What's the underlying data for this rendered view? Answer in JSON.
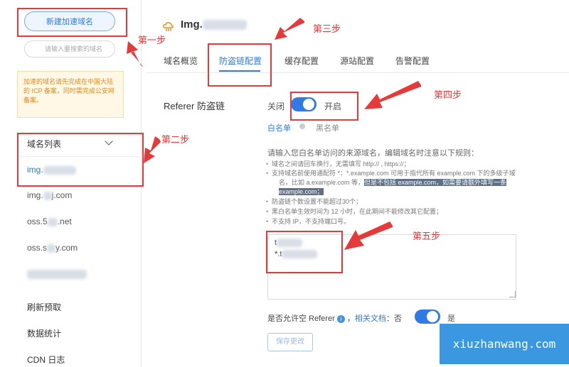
{
  "sidebar": {
    "new_domain_button": "新建加速域名",
    "search_placeholder": "请输入要搜索的域名",
    "notice": "加速的域名请先完成在中国大陆的 ICP 备案，同时需完成公安网备案。",
    "list_title": "域名列表",
    "domains": [
      "img.",
      "img.",
      "oss.5",
      "oss.s"
    ],
    "domain_suffixes": [
      "",
      "j.com",
      ".net",
      "y.com"
    ],
    "menu": [
      "刷新预取",
      "数据统计",
      "CDN 日志"
    ]
  },
  "header": {
    "title": "Img."
  },
  "tabs": [
    "域名概览",
    "防盗链配置",
    "缓存配置",
    "源站配置",
    "告警配置"
  ],
  "referer": {
    "section_label": "Referer 防盗链",
    "off_label": "关闭",
    "on_label": "开启",
    "whitelist_label": "白名单",
    "blacklist_label": "黑名单",
    "rules_title": "请输入您白名单访问的来源域名，编辑域名时注意以下规则：",
    "rules": [
      "域名之间请回车换行，无需填写 http:// , https://；",
      "支持域名前使用通配符 *：*.example.com 可用于指代所有 example.com 下的多级子域",
      "名，比如 a.example.com 等，",
      "但是不包括 example.com，如需要请额外填写一条",
      "example.com；",
      "防盗链个数设置不能超过30个；",
      "黑白名单生效时间为 12 小时，在此期间不能修改其它配置；",
      "不支持 IP，不支持端口号。"
    ],
    "textarea_lines": [
      "t",
      "*.t"
    ],
    "allow_empty_label": "是否允许空 Referer",
    "docs_link": "相关文档",
    "allow_empty_suffix": "：否",
    "allow_empty_on": "是",
    "save_button": "保存更改"
  },
  "annotations": [
    "第一步",
    "第二步",
    "第三步",
    "第四步",
    "第五步"
  ],
  "watermark": "xiuzhanwang.com",
  "colors": {
    "accent": "#2f7be6",
    "annotation": "#e63a3a",
    "watermark_bg": "#3b98e0"
  }
}
